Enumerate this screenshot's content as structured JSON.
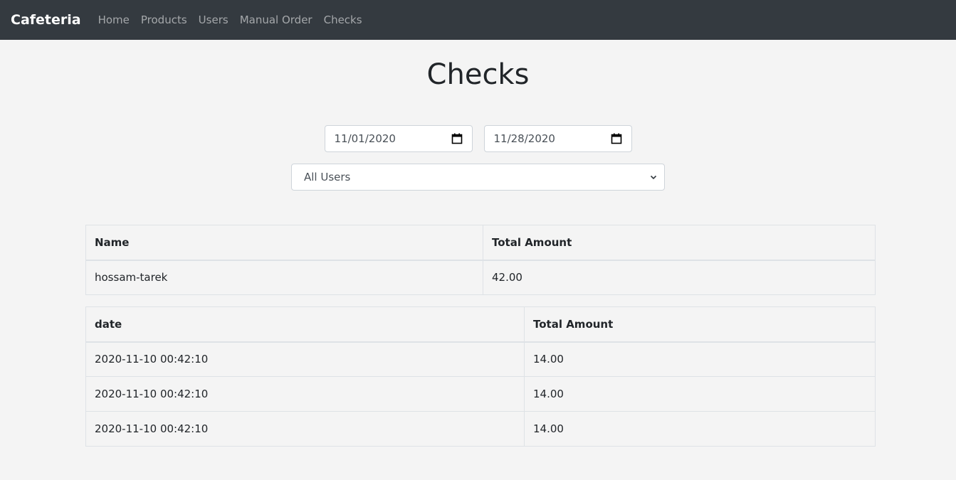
{
  "navbar": {
    "brand": "Cafeteria",
    "links": [
      "Home",
      "Products",
      "Users",
      "Manual Order",
      "Checks"
    ]
  },
  "page": {
    "title": "Checks"
  },
  "filters": {
    "date_from": "11/01/2020",
    "date_to": "11/28/2020",
    "user_select": "All Users"
  },
  "users_table": {
    "headers": [
      "Name",
      "Total Amount"
    ],
    "rows": [
      [
        "hossam-tarek",
        "42.00"
      ]
    ]
  },
  "orders_table": {
    "headers": [
      "date",
      "Total Amount"
    ],
    "rows": [
      [
        "2020-11-10 00:42:10",
        "14.00"
      ],
      [
        "2020-11-10 00:42:10",
        "14.00"
      ],
      [
        "2020-11-10 00:42:10",
        "14.00"
      ]
    ]
  },
  "icons": {
    "calendar": "calendar-icon",
    "dropdown": "chevron-down-icon"
  },
  "colors": {
    "navbar_bg": "#343a40",
    "page_bg": "#f4f4f4",
    "border": "#dee2e6"
  }
}
